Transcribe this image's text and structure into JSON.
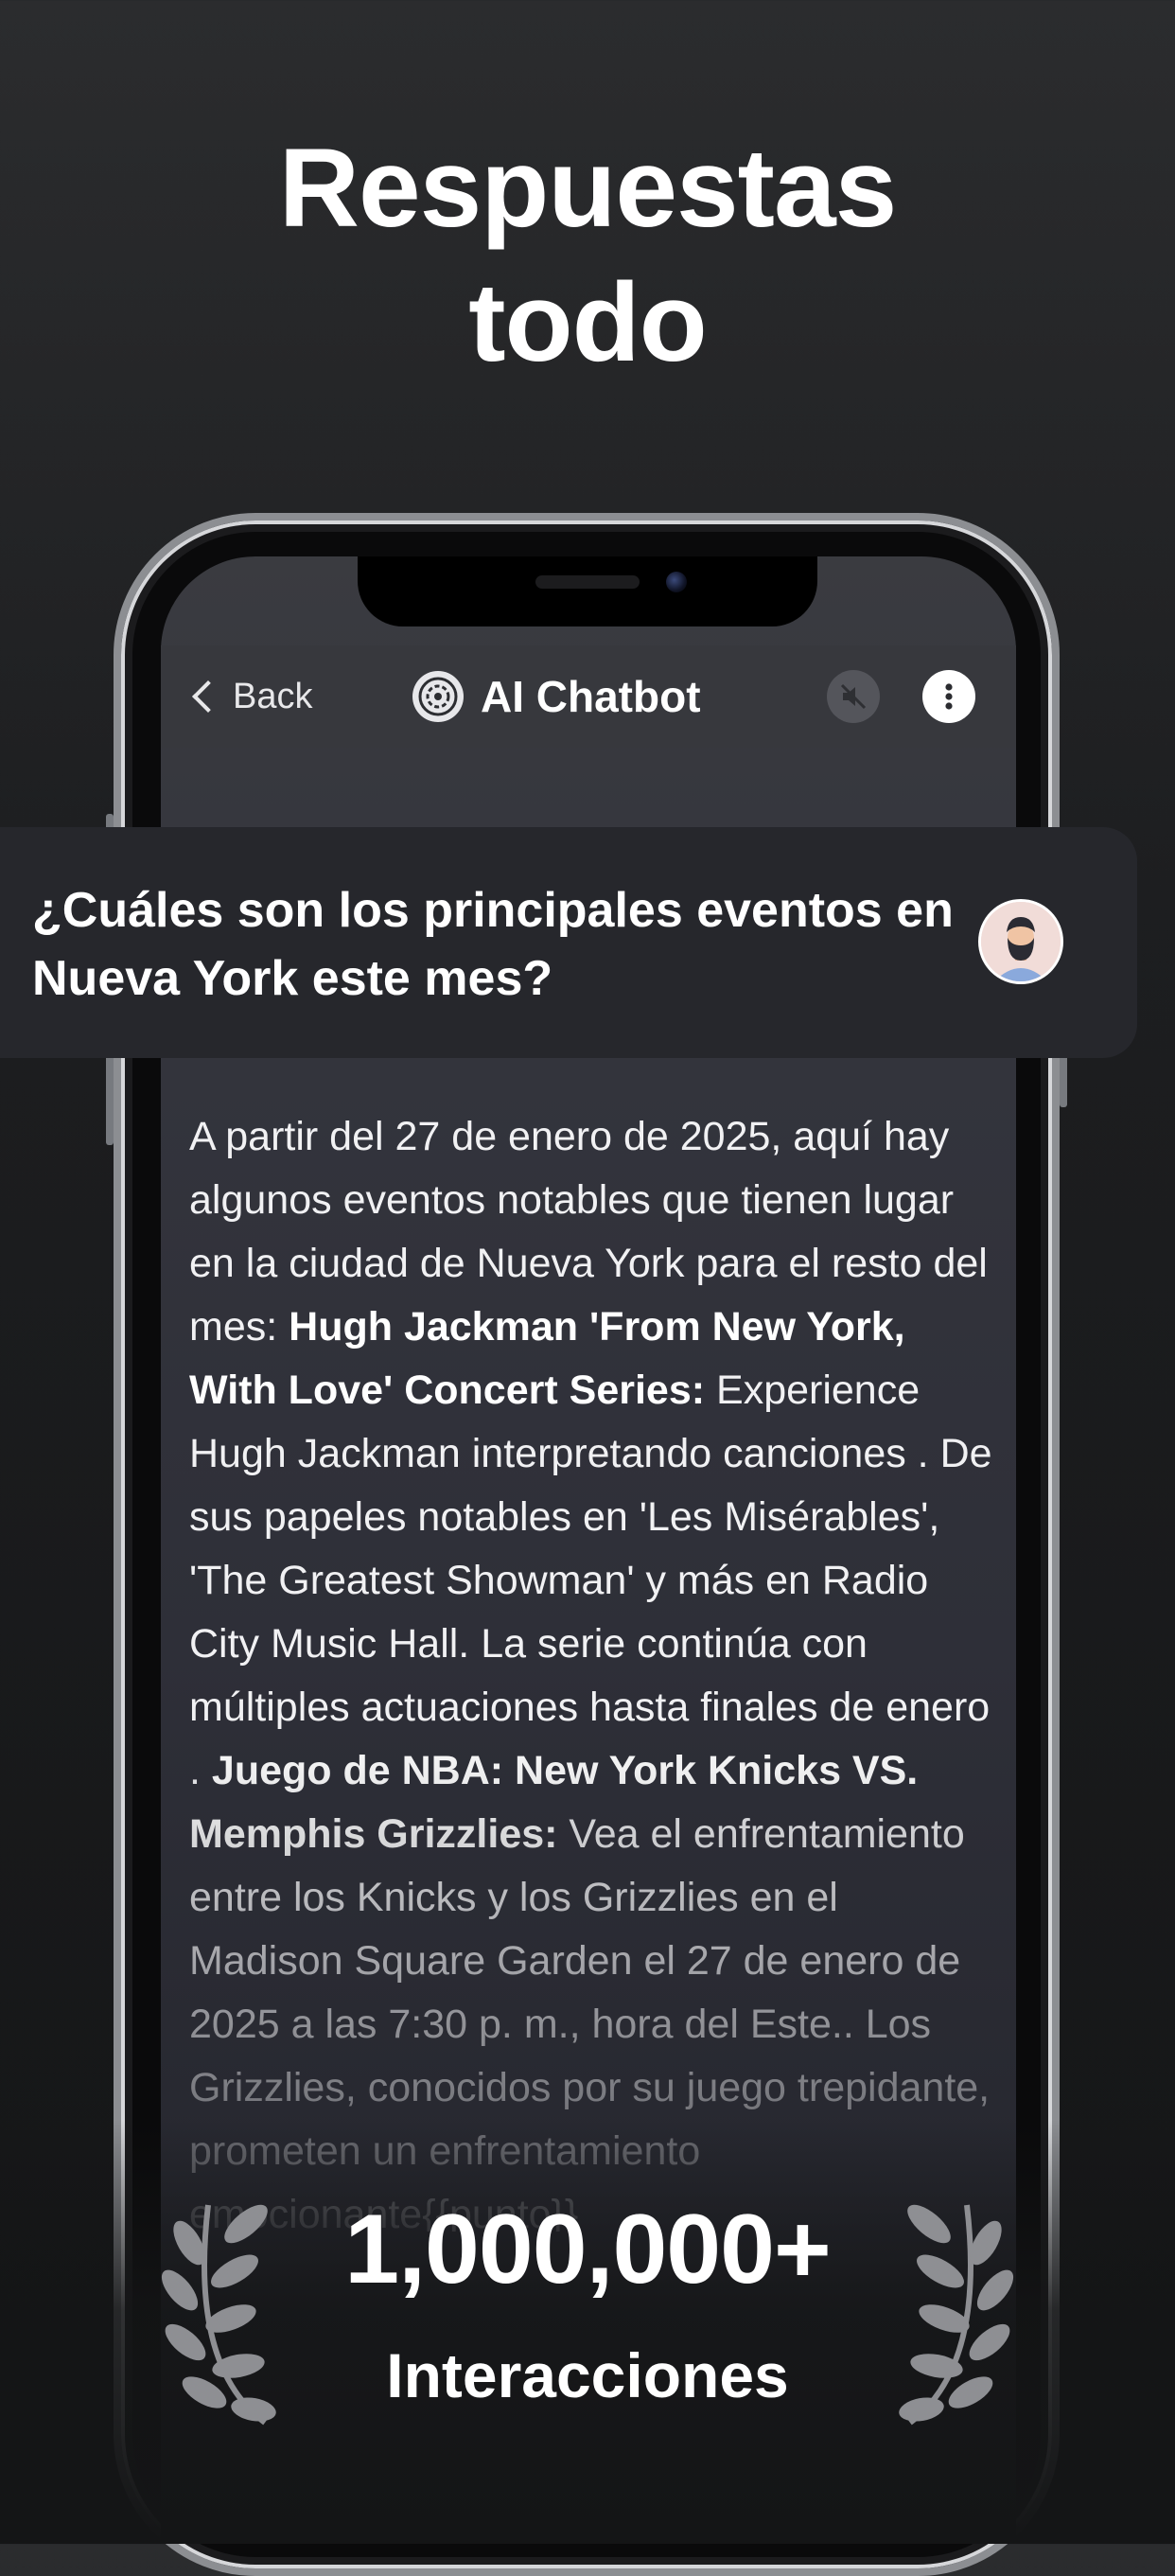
{
  "headline": {
    "line1": "Respuestas",
    "line2": "todo"
  },
  "nav": {
    "back_label": "Back",
    "title": "AI Chatbot",
    "logo_icon": "chatbot-logo-icon",
    "mute_icon": "mute-speaker-icon",
    "more_icon": "more-vertical-icon"
  },
  "chat": {
    "question": "¿Cuáles son los principales eventos en Nueva York este mes?",
    "answer": {
      "p1": "A partir del 27 de enero de 2025, aquí hay algunos eventos notables que tienen lugar en la ciudad de Nueva York para el resto del mes: ",
      "b1": "Hugh Jackman 'From New York, With Love' Concert Series:",
      "p2": " Experience Hugh Jackman interpretando canciones . De sus papeles notables en 'Les Misérables', 'The Greatest Showman' y más en Radio City Music Hall. La serie continúa con múltiples actuaciones hasta finales de enero . ",
      "b2": "Juego de NBA: New York Knicks VS. Memphis Grizzlies:",
      "p3": " Vea el enfrentamiento entre los Knicks y los Grizzlies en el Madison Square Garden el 27 de enero de 2025 a las 7:30 p. m., hora del Este.. Los Grizzlies, conocidos por su juego trepidante, prometen un enfrentamiento emocionante{{punto}}"
    }
  },
  "stats": {
    "number": "1,000,000+",
    "label": "Interacciones"
  },
  "colors": {
    "background": "#1d1e20",
    "screen": "#2e2f38",
    "card": "#26272c",
    "laurel": "#8e8f93"
  }
}
